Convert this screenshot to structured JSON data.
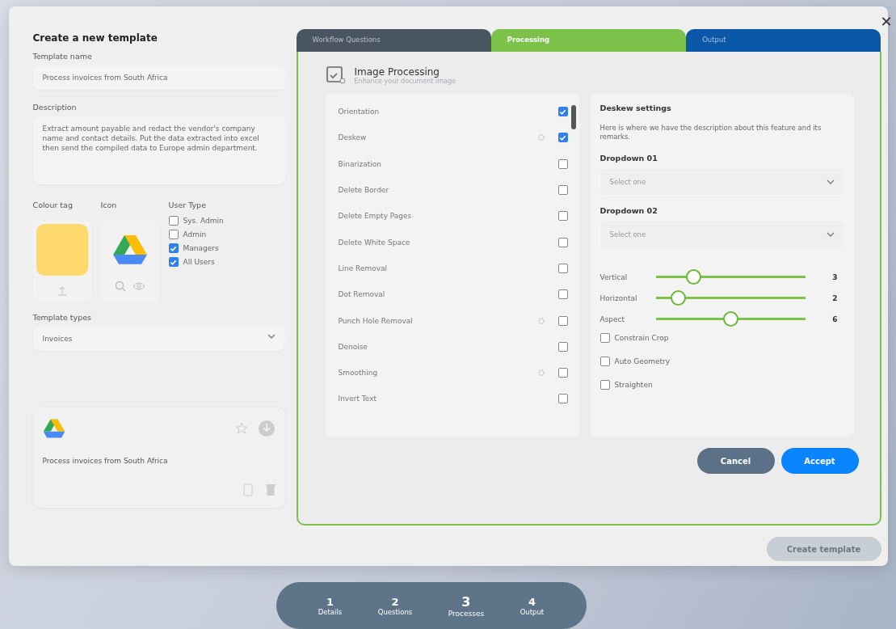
{
  "title": "Create a new template",
  "close_label": "✕",
  "template_name": {
    "label": "Template name",
    "value": "Process invoices from South Africa"
  },
  "description": {
    "label": "Description",
    "value": "Extract amount payable and redact the vendor's company name and contact details. Put the data extracted into excel then send the compiled data to Europe admin department."
  },
  "colour_tag": {
    "label": "Colour tag",
    "color": "#ffd86e"
  },
  "icon": {
    "label": "Icon"
  },
  "user_type": {
    "label": "User Type",
    "options": [
      {
        "label": "Sys. Admin",
        "checked": false
      },
      {
        "label": "Admin",
        "checked": false
      },
      {
        "label": "Managers",
        "checked": true
      },
      {
        "label": "All Users",
        "checked": true
      }
    ]
  },
  "template_types": {
    "label": "Template types",
    "value": "Invoices"
  },
  "preview_card": {
    "name": "Process invoices from South Africa"
  },
  "tabs": [
    {
      "label": "Workflow Questions",
      "selected": false,
      "color": "#4a5562"
    },
    {
      "label": "Processing",
      "selected": true,
      "color": "#7cc24a"
    },
    {
      "label": "Output",
      "selected": false,
      "color": "#0b57a8"
    }
  ],
  "section": {
    "title": "Image Processing",
    "subtitle": "Enhance your document image"
  },
  "options": [
    {
      "label": "Orientation",
      "checked": true,
      "settings": false
    },
    {
      "label": "Deskew",
      "checked": true,
      "settings": true
    },
    {
      "label": "Binarization",
      "checked": false,
      "settings": false
    },
    {
      "label": "Delete Border",
      "checked": false,
      "settings": false
    },
    {
      "label": "Delete Empty Pages",
      "checked": false,
      "settings": false
    },
    {
      "label": "Delete White Space",
      "checked": false,
      "settings": false
    },
    {
      "label": "Line Removal",
      "checked": false,
      "settings": false
    },
    {
      "label": "Dot Removal",
      "checked": false,
      "settings": false
    },
    {
      "label": "Punch Hole Removal",
      "checked": false,
      "settings": true
    },
    {
      "label": "Denoise",
      "checked": false,
      "settings": false
    },
    {
      "label": "Smoothing",
      "checked": false,
      "settings": true
    },
    {
      "label": "Invert Text",
      "checked": false,
      "settings": false
    }
  ],
  "settings": {
    "title": "Deskew settings",
    "description": "Here is where we have the description about this feature and its remarks.",
    "dropdowns": [
      {
        "label": "Dropdown 01",
        "placeholder": "Select one"
      },
      {
        "label": "Dropdown 02",
        "placeholder": "Select one"
      }
    ],
    "sliders": [
      {
        "label": "Vertical",
        "level": 0.25,
        "reading": "3"
      },
      {
        "label": "Horizontal",
        "level": 0.15,
        "reading": "2"
      },
      {
        "label": "Aspect",
        "level": 0.5,
        "reading": "6"
      }
    ],
    "checkboxes": [
      {
        "label": "Constrain Crop",
        "checked": false
      },
      {
        "label": "Auto Geometry",
        "checked": false
      },
      {
        "label": "Straighten",
        "checked": false
      }
    ]
  },
  "buttons": [
    {
      "label": "Cancel",
      "kind": "secondary"
    },
    {
      "label": "Accept",
      "kind": "primary"
    }
  ],
  "create_button": {
    "label": "Create template",
    "disabled": true
  },
  "steps": [
    {
      "number": "1",
      "label": "Details",
      "selected": false
    },
    {
      "number": "2",
      "label": "Questions",
      "selected": false
    },
    {
      "number": "3",
      "label": "Processes",
      "selected": true
    },
    {
      "number": "4",
      "label": "Output",
      "selected": false
    }
  ]
}
